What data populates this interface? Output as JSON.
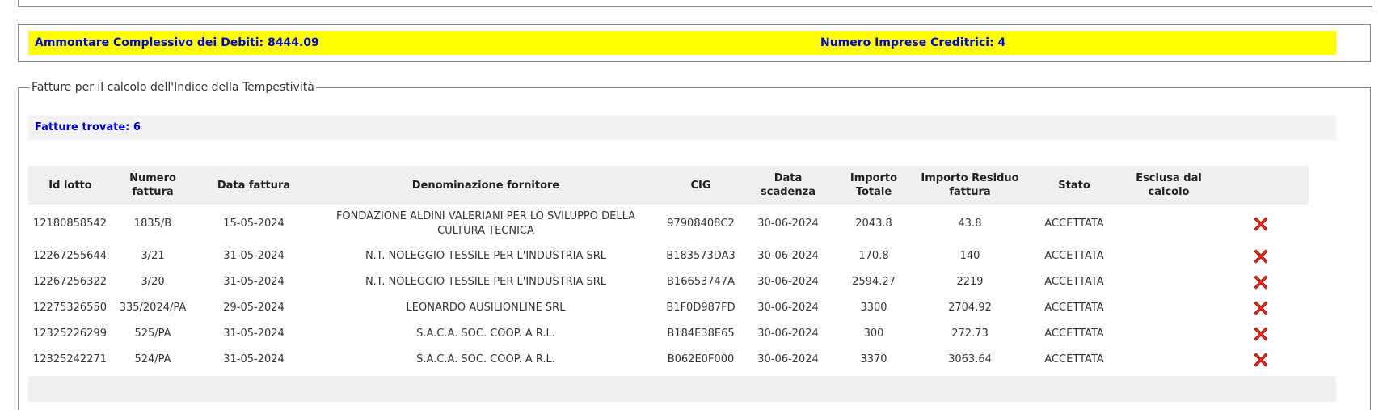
{
  "summary": {
    "debiti": "Ammontare Complessivo dei Debiti: 8444.09",
    "imprese": "Numero Imprese Creditrici: 4"
  },
  "fieldset": {
    "legend": "Fatture per il calcolo dell'Indice della Tempestività",
    "found": "Fatture trovate: 6"
  },
  "table": {
    "headers": [
      "Id lotto",
      "Numero fattura",
      "Data fattura",
      "Denominazione fornitore",
      "CIG",
      "Data scadenza",
      "Importo Totale",
      "Importo Residuo fattura",
      "Stato",
      "Esclusa dal calcolo",
      ""
    ],
    "rows": [
      {
        "id": "12180858542",
        "numero": "1835/B",
        "data": "15-05-2024",
        "fornitore": "FONDAZIONE ALDINI VALERIANI PER LO SVILUPPO DELLA CULTURA TECNICA",
        "cig": "97908408C2",
        "scadenza": "30-06-2024",
        "totale": "2043.8",
        "residuo": "43.8",
        "stato": "ACCETTATA"
      },
      {
        "id": "12267255644",
        "numero": "3/21",
        "data": "31-05-2024",
        "fornitore": "N.T. NOLEGGIO TESSILE PER L'INDUSTRIA SRL",
        "cig": "B183573DA3",
        "scadenza": "30-06-2024",
        "totale": "170.8",
        "residuo": "140",
        "stato": "ACCETTATA"
      },
      {
        "id": "12267256322",
        "numero": "3/20",
        "data": "31-05-2024",
        "fornitore": "N.T. NOLEGGIO TESSILE PER L'INDUSTRIA SRL",
        "cig": "B16653747A",
        "scadenza": "30-06-2024",
        "totale": "2594.27",
        "residuo": "2219",
        "stato": "ACCETTATA"
      },
      {
        "id": "12275326550",
        "numero": "335/2024/PA",
        "data": "29-05-2024",
        "fornitore": "LEONARDO AUSILIONLINE SRL",
        "cig": "B1F0D987FD",
        "scadenza": "30-06-2024",
        "totale": "3300",
        "residuo": "2704.92",
        "stato": "ACCETTATA"
      },
      {
        "id": "12325226299",
        "numero": "525/PA",
        "data": "31-05-2024",
        "fornitore": "S.A.C.A. SOC. COOP. A R.L.",
        "cig": "B184E38E65",
        "scadenza": "30-06-2024",
        "totale": "300",
        "residuo": "272.73",
        "stato": "ACCETTATA"
      },
      {
        "id": "12325242271",
        "numero": "524/PA",
        "data": "31-05-2024",
        "fornitore": "S.A.C.A. SOC. COOP. A R.L.",
        "cig": "B062E0F000",
        "scadenza": "30-06-2024",
        "totale": "3370",
        "residuo": "3063.64",
        "stato": "ACCETTATA"
      }
    ],
    "row_icon": "delete-x-icon"
  },
  "colors": {
    "summary_bg": "#ffff00",
    "summary_text": "#0000cc",
    "icon_red": "#d93025"
  }
}
